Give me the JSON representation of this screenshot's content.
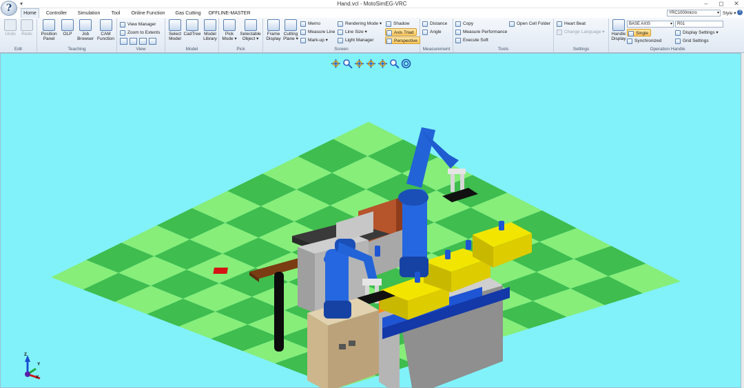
{
  "window": {
    "title": "Hand.vcl - MotoSimEG-VRC",
    "minimize": "–",
    "maximize": "◻",
    "close": "✕",
    "app_button": "?",
    "qat": "▾"
  },
  "tabs": [
    {
      "label": "Home"
    },
    {
      "label": "Controller"
    },
    {
      "label": "Simulation"
    },
    {
      "label": "Tool"
    },
    {
      "label": "Online Function"
    },
    {
      "label": "Gas Cutting"
    },
    {
      "label": "OFFLINE-MASTER"
    }
  ],
  "tabbar_right": {
    "controller_select": "YRC1000micro",
    "style_label": "Style",
    "help": "?"
  },
  "ribbon": {
    "edit": {
      "label": "Edit",
      "undo": "Undo",
      "redo": "Redo"
    },
    "teaching": {
      "label": "Teaching",
      "position_panel_1": "Position",
      "position_panel_2": "Panel",
      "olp": "OLP",
      "job_browser_1": "Job",
      "job_browser_2": "Browser",
      "cam_function_1": "CAM",
      "cam_function_2": "Function"
    },
    "view": {
      "label": "View",
      "view_manager": "View Manager",
      "zoom_to_extents": "Zoom to Extents"
    },
    "model": {
      "label": "Model",
      "select_model_1": "Select",
      "select_model_2": "Model",
      "cadtree": "CadTree",
      "model_library_1": "Model",
      "model_library_2": "Library"
    },
    "pick": {
      "label": "Pick",
      "pick_mode_1": "Pick",
      "pick_mode_2": "Mode ▾",
      "selectable_object_1": "Selectable",
      "selectable_object_2": "Object ▾"
    },
    "screen": {
      "label": "Screen",
      "frame_display_1": "Frame",
      "frame_display_2": "Display",
      "cutting_plane_1": "Cutting",
      "cutting_plane_2": "Plane ▾",
      "memo": "Memo",
      "measure_line": "Measure Line",
      "markup": "Mark-up ▾",
      "rendering_mode": "Rendering Mode ▾",
      "line_size": "Line Size ▾",
      "light_manager": "Light Manager",
      "shadow": "Shadow",
      "axis_triad": "Axis Triad",
      "perspective": "Perspective"
    },
    "measurement": {
      "label": "Measurement",
      "distance": "Distance",
      "angle": "Angle"
    },
    "tools": {
      "label": "Tools",
      "copy": "Copy",
      "measure_performance": "Measure Performance",
      "execute_soft": "Execute Soft",
      "open_cell_folder": "Open Cell Folder"
    },
    "settings": {
      "label": "Settings",
      "heart_beat": "Heart Beat",
      "change_language": "Change Language ▾"
    },
    "operation_handle": {
      "label": "Operation Handle",
      "handle_display_1": "Handle",
      "handle_display_2": "Display",
      "axis_select": "BASE AXIS",
      "robot_select": "R01",
      "single": "Single",
      "synchronized": "Synchronized",
      "display_settings": "Display Settings ▾",
      "grid_settings": "Grid Settings"
    }
  },
  "view_toolbar": [
    "rotate-tool-icon",
    "zoom-window-icon",
    "pan-tool-icon",
    "move-axis-icon",
    "rotate-axis-icon",
    "zoom-tool-icon",
    "fit-view-icon"
  ],
  "axes_triad": {
    "z": "Z",
    "y": "Y",
    "x": "X"
  },
  "colors": {
    "ribbon_bg": "#dfe8f3",
    "viewport_bg": "#81f2fa",
    "floor_light": "#86ee79",
    "floor_dark": "#3fbd4e",
    "robot": "#1f5fd1",
    "highlight": "#ffc95c"
  }
}
